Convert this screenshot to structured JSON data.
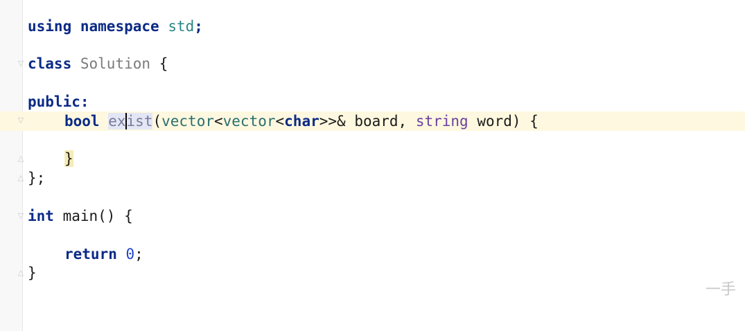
{
  "code": {
    "l1": {
      "using": "using",
      "namespace": "namespace",
      "std": "std",
      "semi": ";"
    },
    "l2": {
      "class": "class",
      "name": "Solution",
      "brace": "{"
    },
    "l3": {
      "public": "public:"
    },
    "l4": {
      "ret": "bool",
      "fn_a": "ex",
      "fn_b": "ist",
      "p1": "(",
      "vec1": "vector",
      "lt1": "<",
      "vec2": "vector",
      "lt2": "<",
      "char": "char",
      "gtamp": ">>& ",
      "board": "board",
      "comma": ", ",
      "string": "string",
      "word": " word) ",
      "brace": "{"
    },
    "l5": {
      "brace": "}"
    },
    "l6": {
      "end": "};"
    },
    "l7": {
      "int": "int",
      "main": " main() {"
    },
    "l8": {
      "ret": "return",
      "zero": "0",
      "semi": ";"
    },
    "l9": {
      "brace": "}"
    }
  },
  "watermark": "一手"
}
